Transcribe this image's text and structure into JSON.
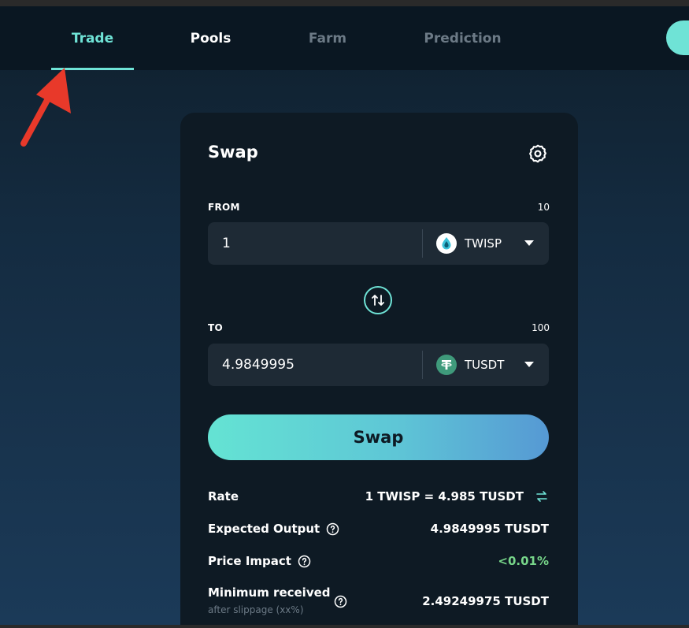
{
  "nav": {
    "tabs": [
      {
        "label": "Trade"
      },
      {
        "label": "Pools"
      },
      {
        "label": "Farm"
      },
      {
        "label": "Prediction"
      }
    ]
  },
  "swap": {
    "title": "Swap",
    "from": {
      "label": "FROM",
      "balance": "10",
      "amount": "1",
      "token": "TWISP",
      "token_icon": "twisp-drop-icon"
    },
    "to": {
      "label": "TO",
      "balance": "100",
      "amount": "4.9849995",
      "token": "TUSDT",
      "token_icon": "tether-icon"
    },
    "button_label": "Swap",
    "info": {
      "rate_label": "Rate",
      "rate_value": "1 TWISP = 4.985 TUSDT",
      "expected_label": "Expected Output",
      "expected_value": "4.9849995 TUSDT",
      "impact_label": "Price Impact",
      "impact_value": "<0.01%",
      "min_label": "Minimum received",
      "min_sub": "after slippage (xx%)",
      "min_value": "2.49249975 TUSDT"
    }
  },
  "colors": {
    "accent": "#6fe3d6",
    "positive": "#77d68a",
    "annotation_arrow": "#e8392a",
    "tether": "#3f9a7b"
  }
}
